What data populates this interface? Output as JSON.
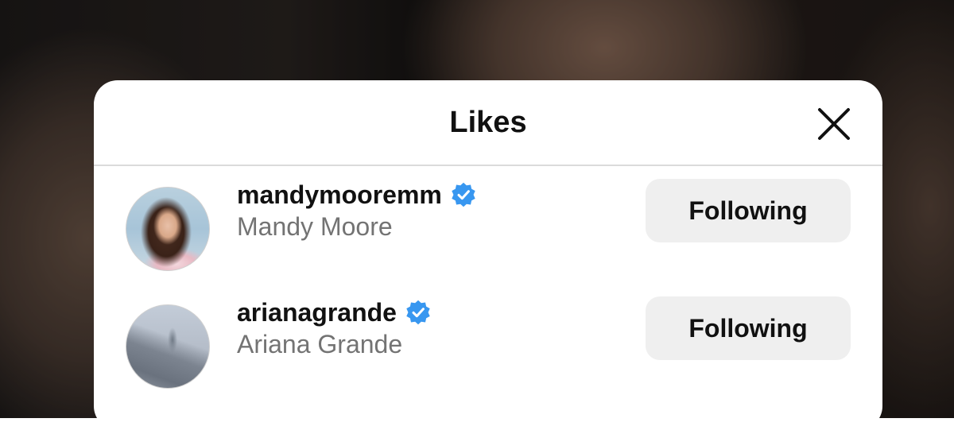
{
  "modal": {
    "title": "Likes",
    "close_icon": "close-icon"
  },
  "likes": [
    {
      "username": "mandymooremm",
      "full_name": "Mandy Moore",
      "verified": true,
      "button_label": "Following"
    },
    {
      "username": "arianagrande",
      "full_name": "Ariana Grande",
      "verified": true,
      "button_label": "Following"
    }
  ],
  "colors": {
    "verified_badge": "#3897f0",
    "button_bg": "#efefef",
    "secondary_text": "#737373"
  }
}
